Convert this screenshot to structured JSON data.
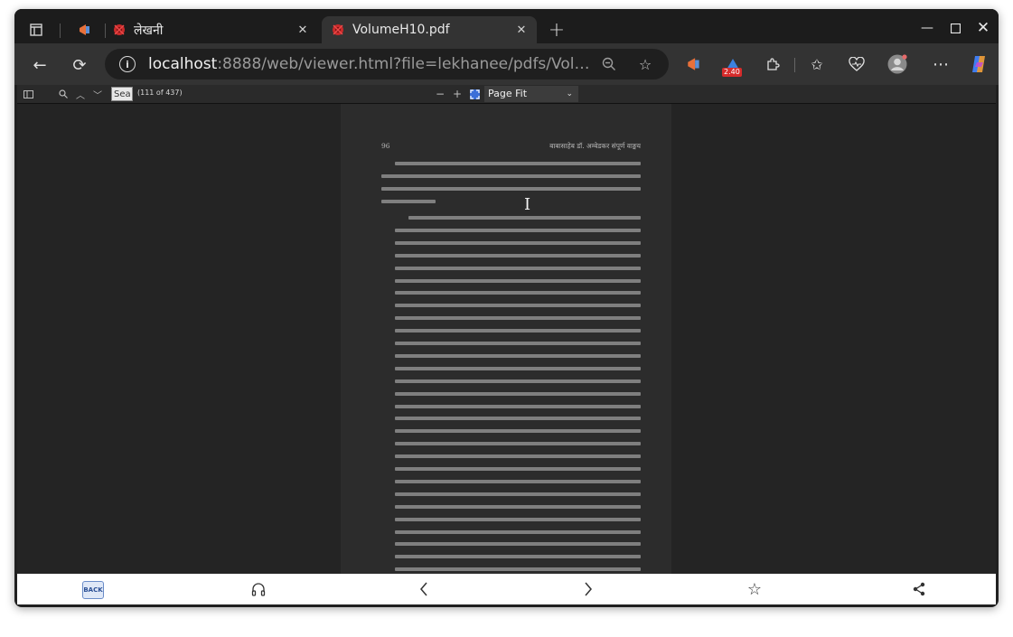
{
  "browser": {
    "tabs": [
      {
        "label": "",
        "favicon": "megaphone-icon",
        "active": false
      },
      {
        "label": "लेखनी",
        "favicon": "ganesha-icon",
        "active": false
      },
      {
        "label": "VolumeH10.pdf",
        "favicon": "ganesha-icon",
        "active": true
      }
    ],
    "new_tab_symbol": "+",
    "address": {
      "host": "localhost",
      "rest": ":8888/web/viewer.html?file=lekhanee/pdfs/Volume..."
    },
    "extension_badge": "2.40"
  },
  "pdf_toolbar": {
    "find_value": "Sea",
    "page_count": "(111 of 437)",
    "zoom_minus": "−",
    "zoom_plus": "+",
    "zoom_value": "Page Fit"
  },
  "page": {
    "number": "96",
    "header": "बाबासाहेब डॉ. अम्बेडकर संपूर्ण वाङ्मय"
  },
  "bottom_bar": {
    "back_label": "BACK"
  },
  "colors": {
    "accent_badge": "#d62b2b",
    "frame": "#202020",
    "toolbar": "#333333"
  }
}
